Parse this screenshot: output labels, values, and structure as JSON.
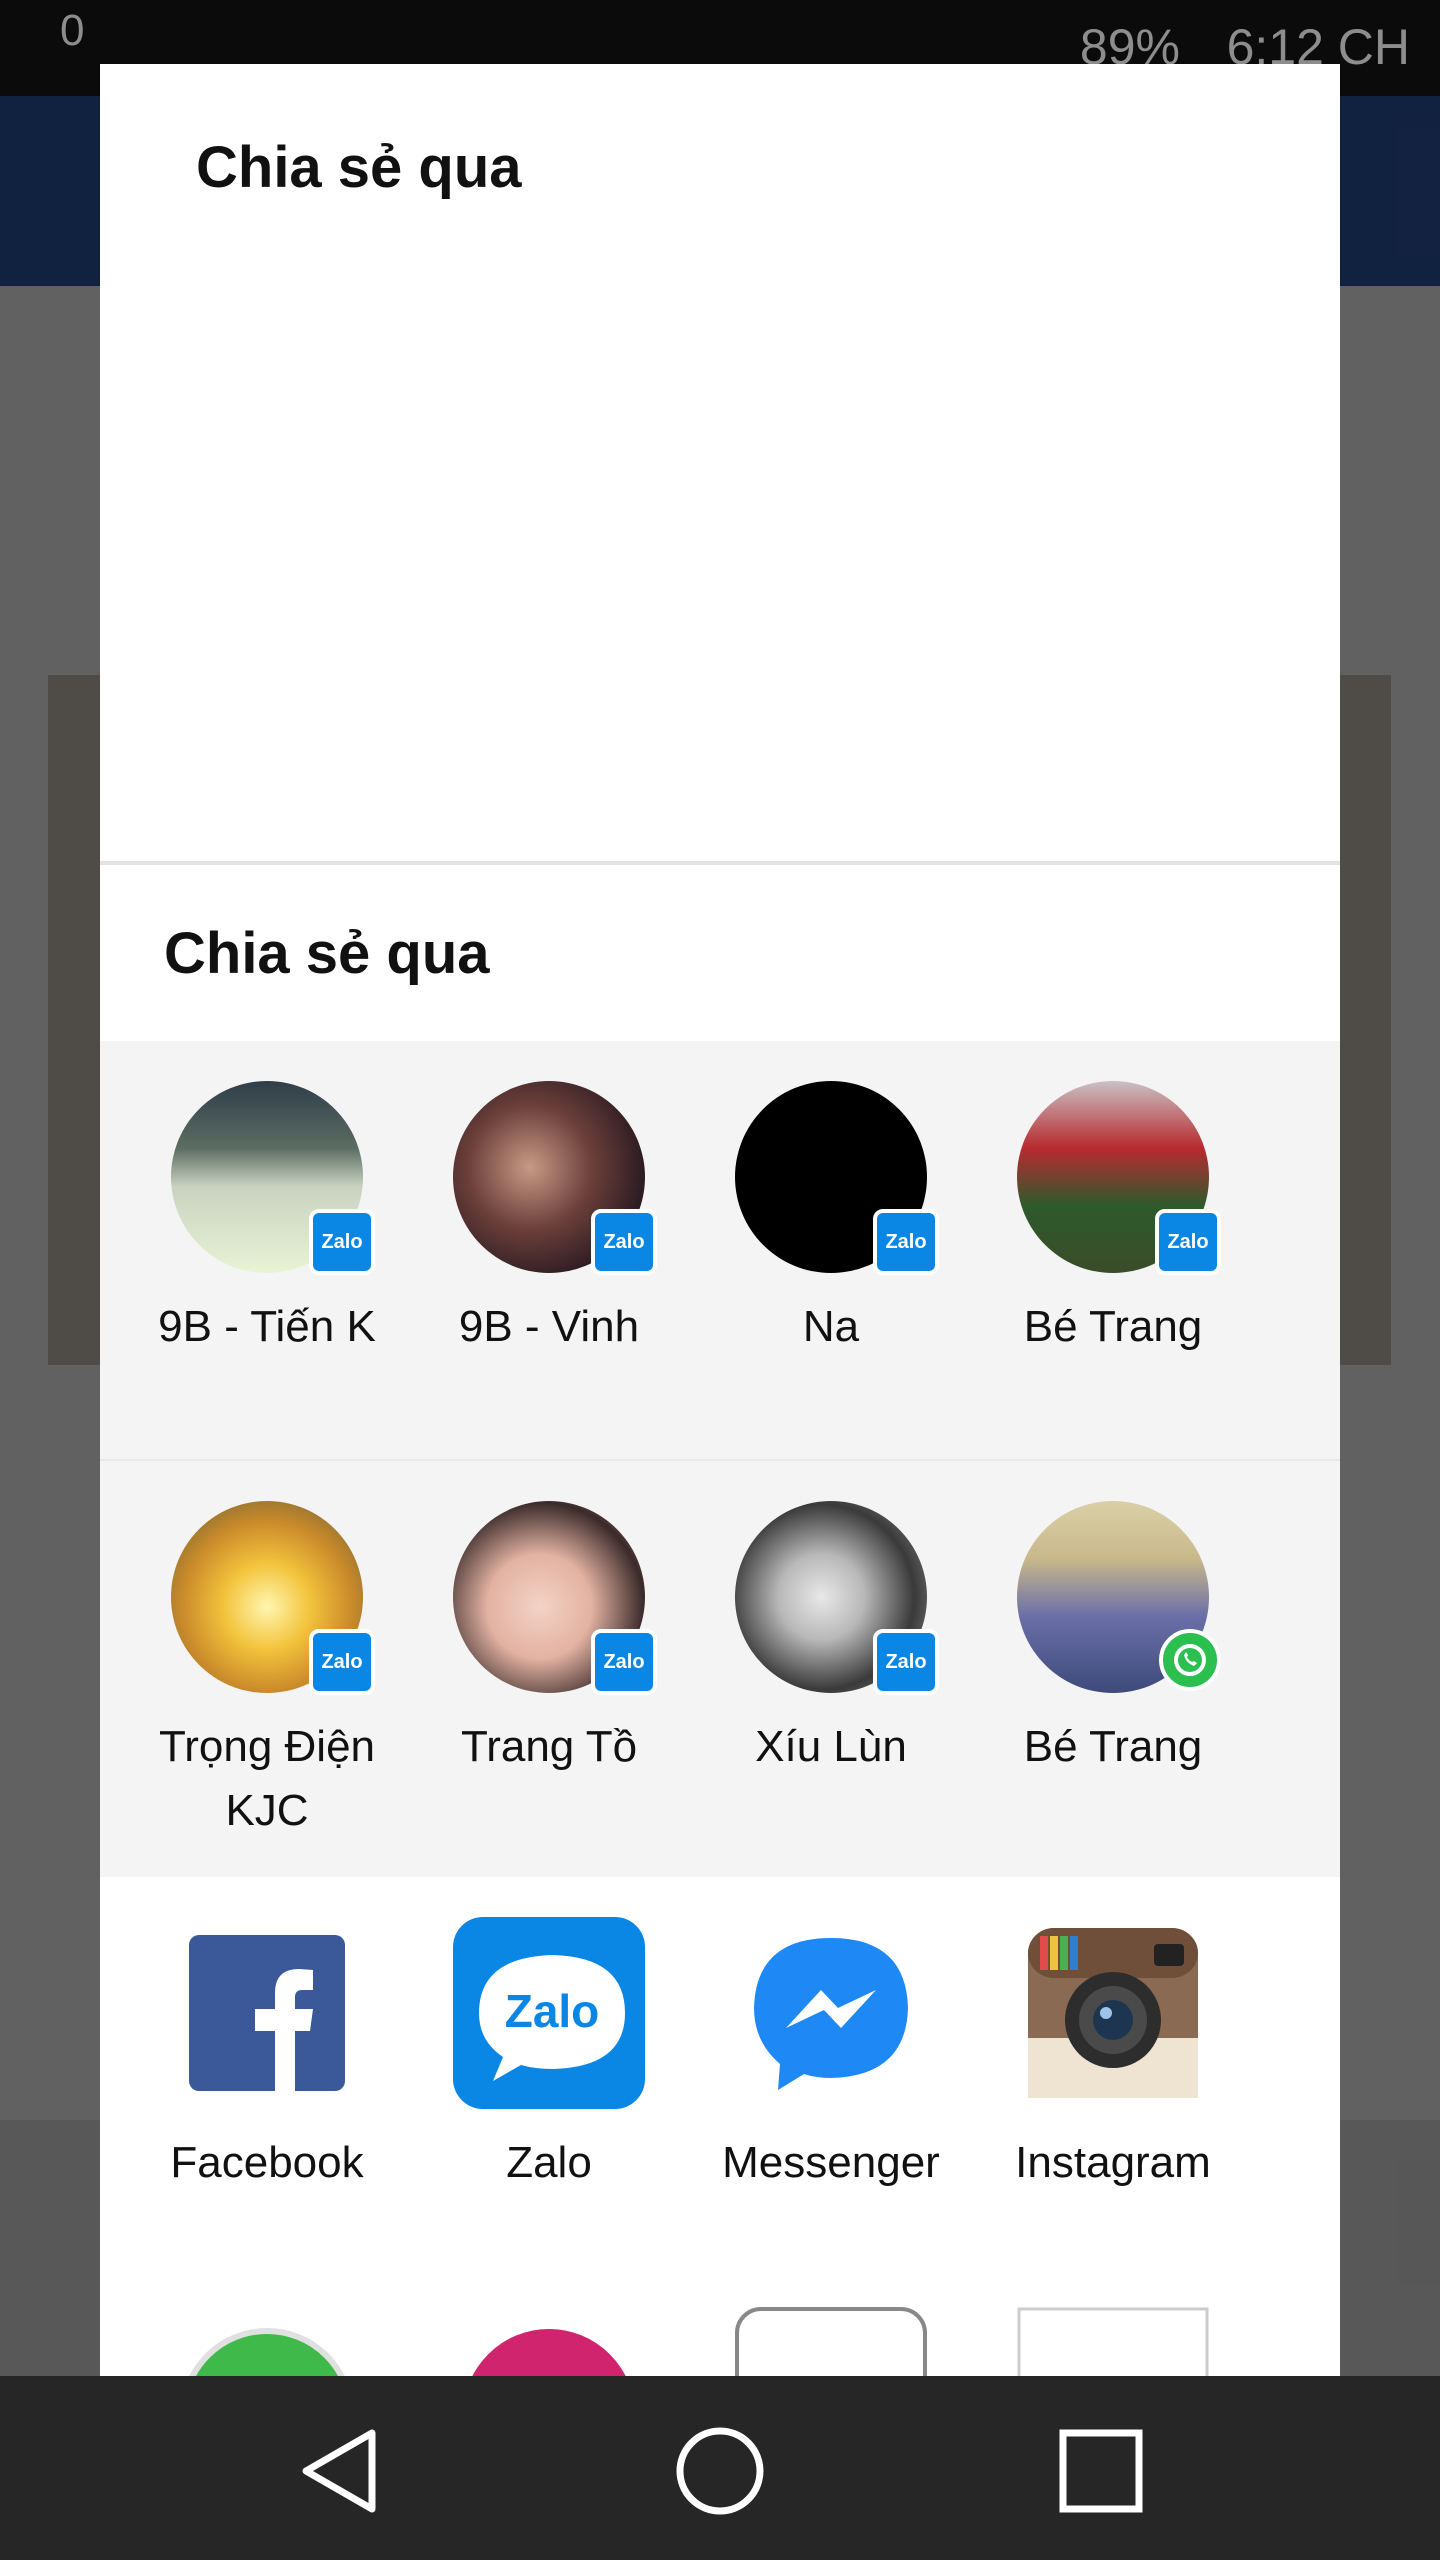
{
  "status_bar": {
    "time": "6:12 CH",
    "battery": "89%",
    "left_indicator": "0"
  },
  "share_sheet": {
    "outer_title": "Chia sẻ qua",
    "inner_title": "Chia sẻ qua",
    "contacts": [
      {
        "name": "9B - Tiến K",
        "app_badge": "Zalo"
      },
      {
        "name": "9B - Vinh",
        "app_badge": "Zalo"
      },
      {
        "name": "Na",
        "app_badge": "Zalo"
      },
      {
        "name": "Bé Trang",
        "app_badge": "Zalo"
      },
      {
        "name": "Trọng Điện KJC",
        "app_badge": "Zalo"
      },
      {
        "name": "Trang Tồ",
        "app_badge": "Zalo"
      },
      {
        "name": "Xíu Lùn",
        "app_badge": "Zalo"
      },
      {
        "name": "Bé Trang",
        "app_badge": "whatsapp-icon"
      }
    ],
    "apps": [
      {
        "label": "Facebook",
        "icon": "facebook-icon"
      },
      {
        "label": "Zalo",
        "icon": "zalo-icon",
        "icon_text": "Zalo"
      },
      {
        "label": "Messenger",
        "icon": "messenger-icon"
      },
      {
        "label": "Instagram",
        "icon": "instagram-icon"
      }
    ]
  },
  "nav_bar": {
    "back": "back-icon",
    "home": "home-icon",
    "recents": "recents-icon"
  },
  "colors": {
    "zalo_blue": "#0a86e5",
    "facebook_blue": "#3b5998",
    "messenger_blue": "#1e88f5",
    "whatsapp_green": "#2bbf4f"
  }
}
